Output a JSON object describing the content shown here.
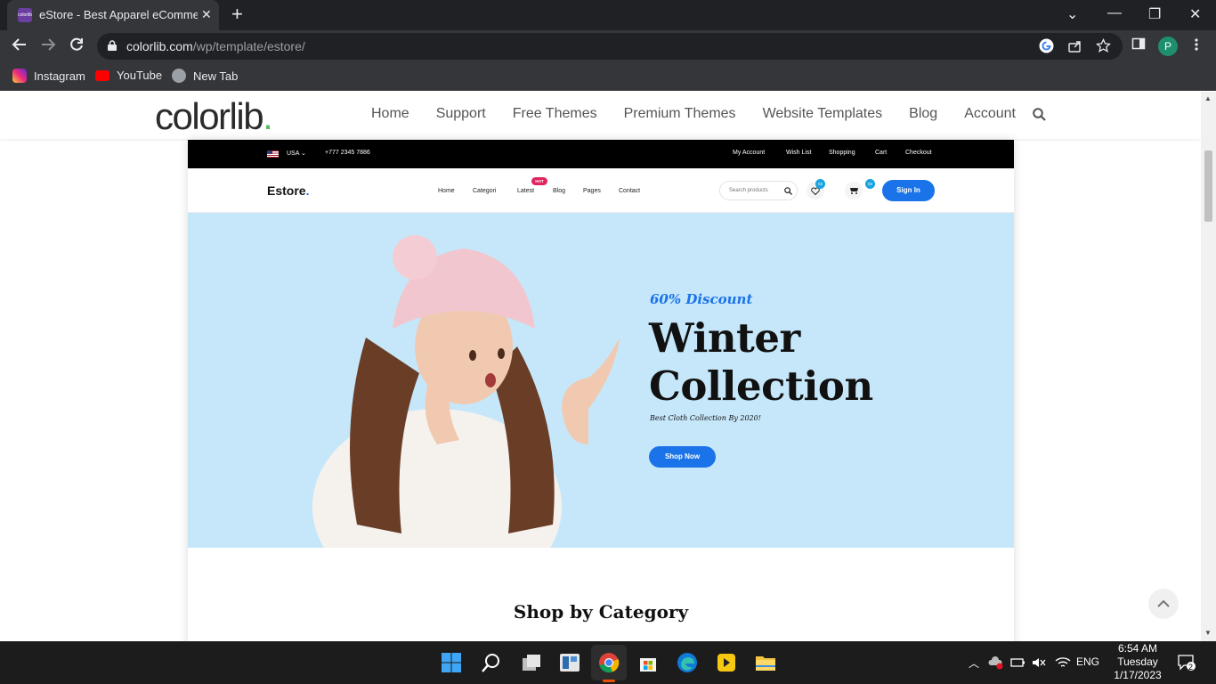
{
  "browser": {
    "tab": {
      "favicon_text": "colorlib",
      "title": "eStore - Best Apparel eCommerce",
      "close_glyph": "✕"
    },
    "new_tab_glyph": "+",
    "window_controls": {
      "chevron": "⌄",
      "minimize": "—",
      "restore": "❐",
      "close": "✕"
    },
    "url": {
      "domain": "colorlib.com",
      "path": "/wp/template/estore/"
    },
    "profile_initial": "P",
    "bookmarks": [
      {
        "label": "Instagram",
        "icon": "instagram-icon",
        "color": "#d6249f"
      },
      {
        "label": "YouTube",
        "icon": "youtube-icon",
        "color": "#ff0000"
      },
      {
        "label": "New Tab",
        "icon": "globe-icon",
        "color": "#9aa0a6"
      }
    ]
  },
  "colorlib": {
    "logo": "colorlib",
    "logo_dot": ".",
    "nav": [
      "Home",
      "Support",
      "Free Themes",
      "Premium Themes",
      "Website Templates",
      "Blog",
      "Account"
    ]
  },
  "estore": {
    "topbar": {
      "country": "USA",
      "phone": "+777 2345 7886",
      "links": [
        "My Account",
        "Wish List",
        "Shopping",
        "Cart",
        "Checkout"
      ]
    },
    "logo": "Estore",
    "logo_dot": ".",
    "nav": [
      "Home",
      "Categori",
      "Latest",
      "Blog",
      "Pages",
      "Contact"
    ],
    "hot_badge": "HOT",
    "search_placeholder": "Search products",
    "wishlist_count": "02",
    "cart_count": "02",
    "signin": "Sign In",
    "hero": {
      "discount": "60% Discount",
      "title_line1": "Winter",
      "title_line2": "Collection",
      "subtitle": "Best Cloth Collection By 2020!",
      "button": "Shop Now"
    },
    "section_title": "Shop by Category"
  },
  "taskbar": {
    "language": "ENG",
    "time": "6:54 AM",
    "day": "Tuesday",
    "date": "1/17/2023",
    "notification_count": "2"
  },
  "colors": {
    "accent": "#1a73e8",
    "hero_bg": "#c6e7fa",
    "chrome_dark": "#202124",
    "chrome_mid": "#35363a"
  }
}
